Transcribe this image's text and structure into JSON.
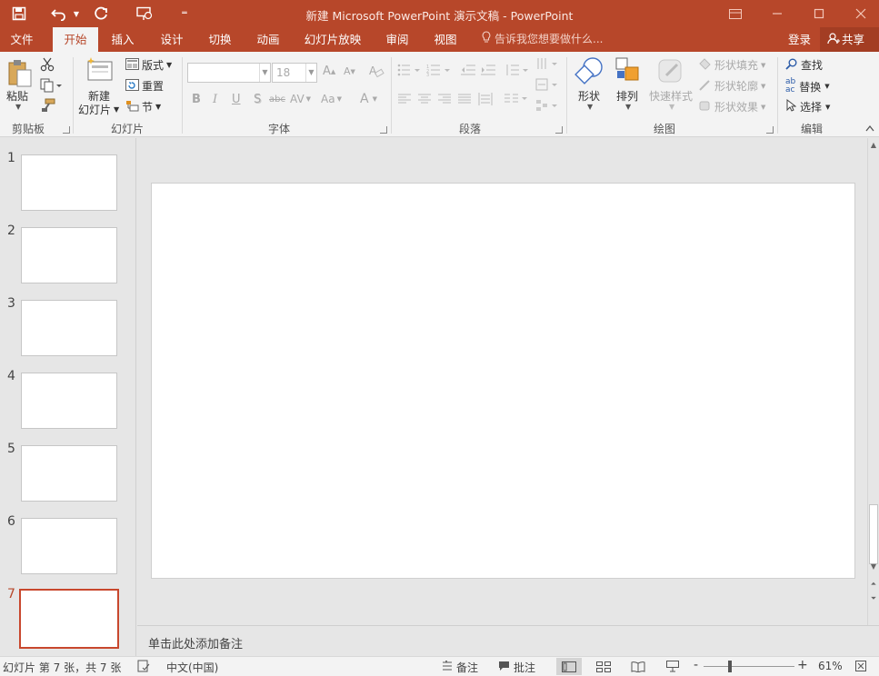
{
  "window": {
    "title": "新建 Microsoft PowerPoint 演示文稿 - PowerPoint"
  },
  "quick_access": {
    "save_icon": "save-icon",
    "undo_icon": "undo-icon",
    "redo_icon": "redo-icon",
    "present_icon": "start-slideshow-icon",
    "customize_icon": "customize-qat-icon"
  },
  "tabs": [
    {
      "label": "文件"
    },
    {
      "label": "开始"
    },
    {
      "label": "插入"
    },
    {
      "label": "设计"
    },
    {
      "label": "切换"
    },
    {
      "label": "动画"
    },
    {
      "label": "幻灯片放映"
    },
    {
      "label": "审阅"
    },
    {
      "label": "视图"
    }
  ],
  "tell_me": "告诉我您想要做什么...",
  "account": {
    "login": "登录",
    "share": "共享"
  },
  "ribbon": {
    "clipboard": {
      "label": "剪贴板",
      "paste": "粘贴"
    },
    "slides": {
      "label": "幻灯片",
      "new_slide_line1": "新建",
      "new_slide_line2": "幻灯片",
      "layout": "版式",
      "reset": "重置",
      "section": "节"
    },
    "font": {
      "label": "字体",
      "font_name": "",
      "font_size": "18",
      "bold": "B",
      "italic": "I",
      "underline": "U",
      "shadow": "S",
      "strike": "abc",
      "spacing": "AV",
      "case": "Aa",
      "color": "A"
    },
    "paragraph": {
      "label": "段落"
    },
    "drawing": {
      "label": "绘图",
      "shapes": "形状",
      "arrange": "排列",
      "quick_styles": "快速样式",
      "fill": "形状填充",
      "outline": "形状轮廓",
      "effects": "形状效果"
    },
    "editing": {
      "label": "编辑",
      "find": "查找",
      "replace": "替换",
      "select": "选择"
    }
  },
  "slides": [
    {
      "number": "1"
    },
    {
      "number": "2"
    },
    {
      "number": "3"
    },
    {
      "number": "4"
    },
    {
      "number": "5"
    },
    {
      "number": "6"
    },
    {
      "number": "7"
    }
  ],
  "selected_slide": 7,
  "notes_placeholder": "单击此处添加备注",
  "status": {
    "slide_info": "幻灯片 第 7 张，共 7 张",
    "language": "中文(中国)",
    "notes": "备注",
    "comments": "批注",
    "zoom": "61%"
  },
  "colors": {
    "accent": "#b7472a",
    "selected_border": "#c8472d"
  }
}
